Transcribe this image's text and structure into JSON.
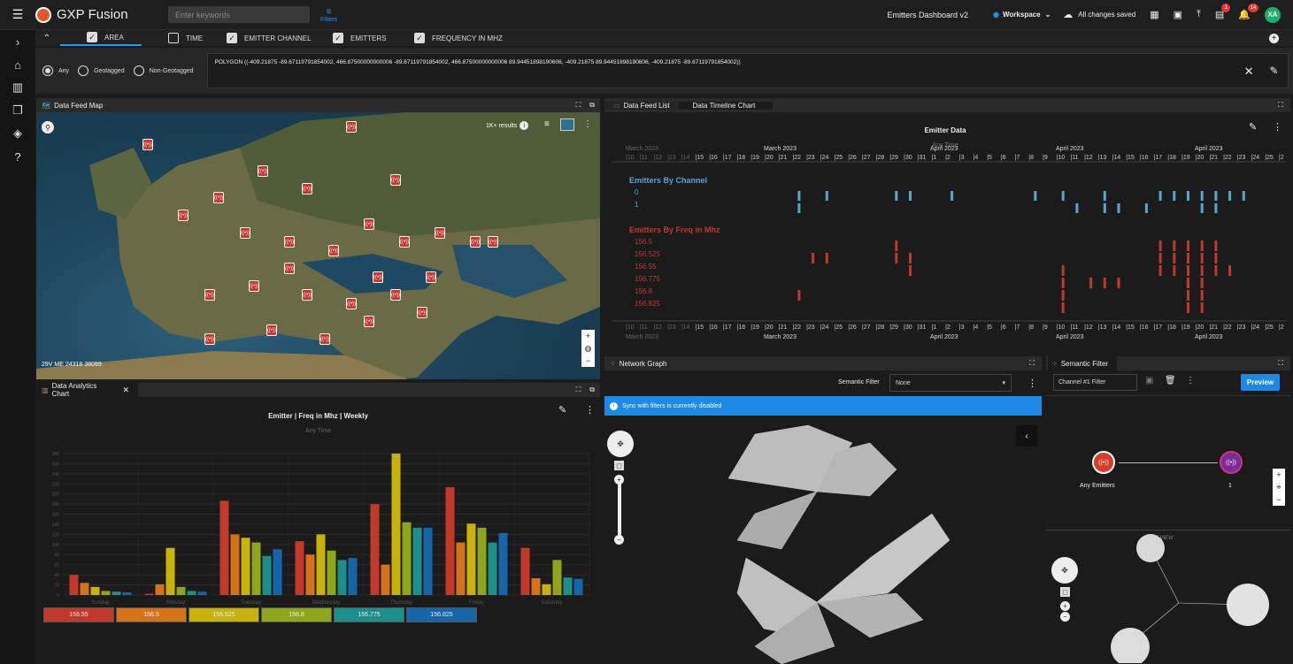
{
  "app": {
    "name": "GXP Fusion",
    "search_placeholder": "Enter keywords",
    "filters_label": "Filters"
  },
  "header": {
    "dashboard_name": "Emitters Dashboard v2",
    "workspace_label": "Workspace",
    "save_status": "All changes saved",
    "notif_badge_1": "1",
    "notif_badge_2": "14",
    "avatar_initials": "XA"
  },
  "filters": {
    "checkboxes": [
      {
        "label": "AREA",
        "checked": true
      },
      {
        "label": "TIME",
        "checked": false
      },
      {
        "label": "EMITTER CHANNEL",
        "checked": true
      },
      {
        "label": "EMITTERS",
        "checked": true
      },
      {
        "label": "FREQUENCY IN MHZ",
        "checked": true
      }
    ],
    "geo_options": [
      {
        "label": "Any",
        "selected": true
      },
      {
        "label": "Geotagged",
        "selected": false
      },
      {
        "label": "Non-Geotagged",
        "selected": false
      }
    ],
    "polygon": "POLYGON ((-409.21875 -89.67119791854002, 466.87500000000006 -89.67119791854002, 466.87500000000006 89.94451898190606, -409.21875 89.94451898190606, -409.21875 -89.67119791854002))"
  },
  "map_panel": {
    "title": "Data Feed Map",
    "results": "1K+ results",
    "coords": "29V ME 24318 38099"
  },
  "timeline_panel": {
    "tabs": [
      "Data Feed List",
      "Data Timeline Chart"
    ],
    "title": "Emitter Data",
    "subtitle": "Any Time",
    "month_labels": [
      "March 2023",
      "March 2023",
      "April 2023",
      "April 2023",
      "April 2023"
    ],
    "days": [
      "10",
      "11",
      "12",
      "13",
      "14",
      "15",
      "16",
      "17",
      "18",
      "19",
      "20",
      "21",
      "22",
      "23",
      "24",
      "25",
      "26",
      "27",
      "28",
      "29",
      "30",
      "31",
      "1",
      "2",
      "3",
      "4",
      "5",
      "6",
      "7",
      "8",
      "9",
      "10",
      "11",
      "12",
      "13",
      "14",
      "15",
      "16",
      "17",
      "18",
      "19",
      "20",
      "21",
      "22",
      "23",
      "24",
      "25",
      "2"
    ],
    "group1_title": "Emitters By Channel",
    "channels": [
      "0",
      "1"
    ],
    "group2_title": "Emitters By Freq in Mhz",
    "freqs": [
      "156.5",
      "156.525",
      "156.55",
      "156.775",
      "156.8",
      "156.825"
    ],
    "colors": {
      "channel": "#4fa8d8",
      "freq": "#c0392b"
    }
  },
  "chart_panel": {
    "title_tab": "Data Analytics Chart",
    "chart_title": "Emitter | Freq in Mhz | Weekly",
    "chart_subtitle": "Any Time"
  },
  "chart_data": {
    "type": "bar",
    "title": "Emitter | Freq in Mhz | Weekly",
    "subtitle": "Any Time",
    "categories": [
      "Sunday",
      "Monday",
      "Tuesday",
      "Wednesday",
      "Thursday",
      "Friday",
      "Saturday"
    ],
    "ylim": [
      0,
      210
    ],
    "yticks": [
      0,
      15,
      30,
      45,
      60,
      75,
      90,
      105,
      120,
      135,
      150,
      165,
      180,
      195,
      210
    ],
    "ytick_labels": [
      "0",
      "20",
      "40",
      "60",
      "80",
      "100",
      "120",
      "140",
      "160",
      "180",
      "200",
      "220",
      "240",
      "260",
      "280"
    ],
    "series": [
      {
        "name": "156.55",
        "color": "#c0392b",
        "values": [
          30,
          2,
          140,
          80,
          135,
          160,
          70
        ]
      },
      {
        "name": "156.5",
        "color": "#d4731c",
        "values": [
          18,
          16,
          90,
          60,
          45,
          78,
          25
        ]
      },
      {
        "name": "156.525",
        "color": "#c9b10c",
        "values": [
          12,
          70,
          85,
          90,
          210,
          106,
          16
        ]
      },
      {
        "name": "156.8",
        "color": "#8ea51c",
        "values": [
          6,
          12,
          78,
          66,
          108,
          100,
          52
        ]
      },
      {
        "name": "156.775",
        "color": "#1d8f8a",
        "values": [
          5,
          6,
          58,
          52,
          100,
          78,
          26
        ]
      },
      {
        "name": "156.825",
        "color": "#1565a8",
        "values": [
          4,
          5,
          68,
          55,
          100,
          92,
          24
        ]
      }
    ]
  },
  "network_panel": {
    "title": "Network Graph",
    "semantic_filter_label": "Semantic Filter",
    "semantic_filter_value": "None",
    "sync_notice": "Sync with filters is currently disabled"
  },
  "semantic_panel": {
    "title": "Semantic Filter",
    "filter_name": "Channel #1 Filter",
    "preview_button": "Preview",
    "node_left_label": "Any Emitters",
    "node_right_label": "1",
    "preview_label": "PREVIEW"
  }
}
